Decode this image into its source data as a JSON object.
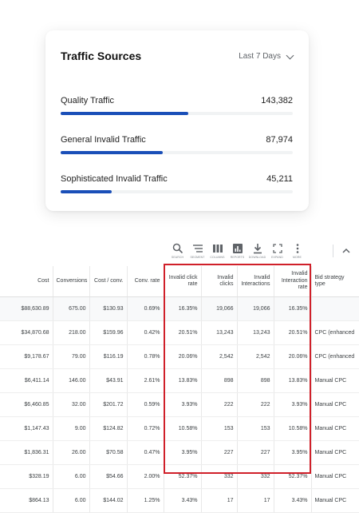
{
  "card": {
    "title": "Traffic Sources",
    "range": "Last 7 Days",
    "sources": [
      {
        "label": "Quality Traffic",
        "value": "143,382",
        "fraction": 0.55
      },
      {
        "label": "General Invalid Traffic",
        "value": "87,974",
        "fraction": 0.44
      },
      {
        "label": "Sophisticated Invalid Traffic",
        "value": "45,211",
        "fraction": 0.22
      }
    ]
  },
  "toolbar": {
    "search": "SEARCH",
    "segment": "SEGMENT",
    "columns": "COLUMNS",
    "reports": "REPORTS",
    "download": "DOWNLOAD",
    "expand": "EXPAND",
    "more": "MORE"
  },
  "table": {
    "headers": [
      "Cost",
      "Conversions",
      "Cost / conv.",
      "Conv. rate",
      "Invalid click rate",
      "Invalid clicks",
      "Invalid Interactions",
      "Invalid Interaction rate",
      "Bid strategy type"
    ],
    "total": [
      "$88,630.89",
      "675.00",
      "$130.93",
      "0.69%",
      "16.35%",
      "19,066",
      "19,066",
      "16.35%",
      ""
    ],
    "rows": [
      [
        "$34,870.68",
        "218.00",
        "$159.96",
        "0.42%",
        "20.51%",
        "13,243",
        "13,243",
        "20.51%",
        "CPC (enhanced"
      ],
      [
        "$9,178.67",
        "79.00",
        "$116.19",
        "0.78%",
        "20.06%",
        "2,542",
        "2,542",
        "20.06%",
        "CPC (enhanced"
      ],
      [
        "$6,411.14",
        "146.00",
        "$43.91",
        "2.61%",
        "13.83%",
        "898",
        "898",
        "13.83%",
        "Manual CPC"
      ],
      [
        "$6,460.85",
        "32.00",
        "$201.72",
        "0.59%",
        "3.93%",
        "222",
        "222",
        "3.93%",
        "Manual CPC"
      ],
      [
        "$1,147.43",
        "9.00",
        "$124.82",
        "0.72%",
        "10.58%",
        "153",
        "153",
        "10.58%",
        "Manual CPC"
      ],
      [
        "$1,836.31",
        "26.00",
        "$70.58",
        "0.47%",
        "3.95%",
        "227",
        "227",
        "3.95%",
        "Manual CPC"
      ],
      [
        "$328.19",
        "6.00",
        "$54.66",
        "2.00%",
        "52.37%",
        "332",
        "332",
        "52.37%",
        "Manual CPC"
      ],
      [
        "$864.13",
        "6.00",
        "$144.02",
        "1.25%",
        "3.43%",
        "17",
        "17",
        "3.43%",
        "Manual CPC"
      ]
    ]
  },
  "colors": {
    "accent": "#1a4fb8",
    "highlight": "#d0202a"
  }
}
